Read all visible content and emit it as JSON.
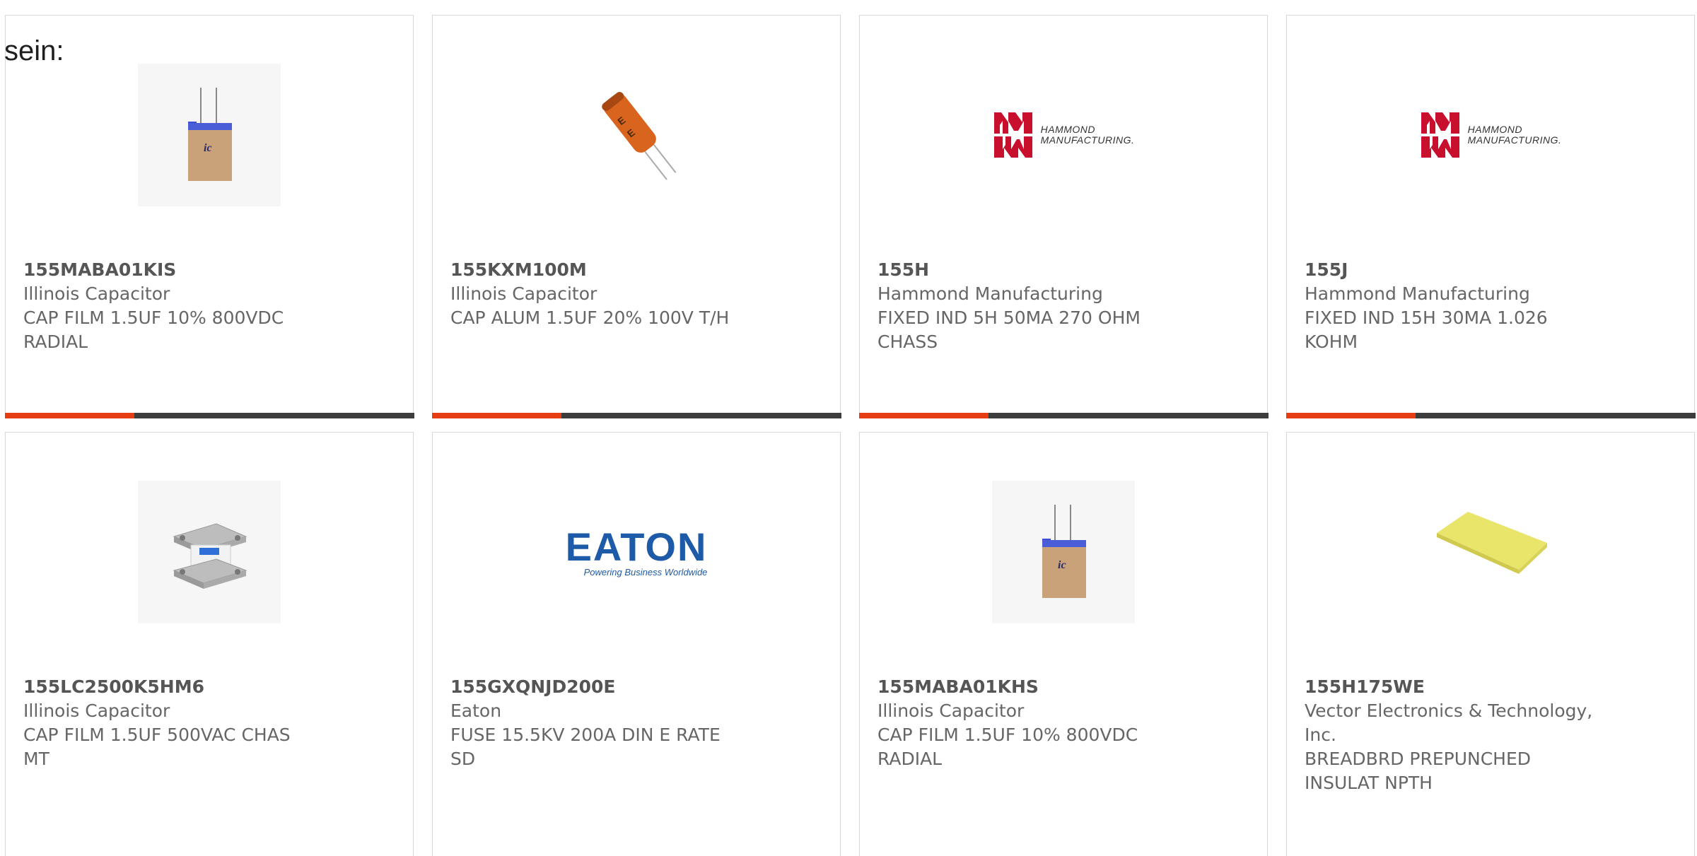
{
  "overlay_text": "sein:",
  "colors": {
    "accent": "#e63e12",
    "bar": "#3d3d3d",
    "border": "#d9d9d9",
    "eaton_blue": "#1d5aa8",
    "hammond_red": "#c8102e"
  },
  "products": [
    {
      "part_number": "155MABA01KIS",
      "manufacturer": "Illinois Capacitor",
      "description_line1": "CAP FILM 1.5UF 10% 800VDC",
      "description_line2": "RADIAL",
      "image": "film-capacitor-icon"
    },
    {
      "part_number": "155KXM100M",
      "manufacturer": "Illinois Capacitor",
      "description_line1": "CAP ALUM 1.5UF 20% 100V T/H",
      "description_line2": "",
      "image": "electrolytic-capacitor-icon"
    },
    {
      "part_number": "155H",
      "manufacturer": "Hammond Manufacturing",
      "description_line1": "FIXED IND 5H 50MA 270 OHM",
      "description_line2": "CHASS",
      "image": "hammond-logo",
      "logo_line1": "HAMMOND",
      "logo_line2": "MANUFACTURING."
    },
    {
      "part_number": "155J",
      "manufacturer": "Hammond Manufacturing",
      "description_line1": "FIXED IND 15H 30MA 1.026",
      "description_line2": "KOHM",
      "image": "hammond-logo",
      "logo_line1": "HAMMOND",
      "logo_line2": "MANUFACTURING."
    },
    {
      "part_number": "155LC2500K5HM6",
      "manufacturer": "Illinois Capacitor",
      "description_line1": "CAP FILM 1.5UF 500VAC CHAS",
      "description_line2": "MT",
      "image": "chassis-capacitor-icon"
    },
    {
      "part_number": "155GXQNJD200E",
      "manufacturer": "Eaton",
      "description_line1": "FUSE 15.5KV 200A DIN E RATE",
      "description_line2": "SD",
      "image": "eaton-logo",
      "logo_word": "EATON",
      "logo_tagline": "Powering Business Worldwide"
    },
    {
      "part_number": "155MABA01KHS",
      "manufacturer": "Illinois Capacitor",
      "description_line1": "CAP FILM 1.5UF 10% 800VDC",
      "description_line2": "RADIAL",
      "image": "film-capacitor-icon"
    },
    {
      "part_number": "155H175WE",
      "manufacturer": "Vector Electronics & Technology,",
      "manufacturer_line2": "Inc.",
      "description_line1": "BREADBRD PREPUNCHED",
      "description_line2": "INSULAT NPTH",
      "image": "breadboard-icon"
    }
  ]
}
